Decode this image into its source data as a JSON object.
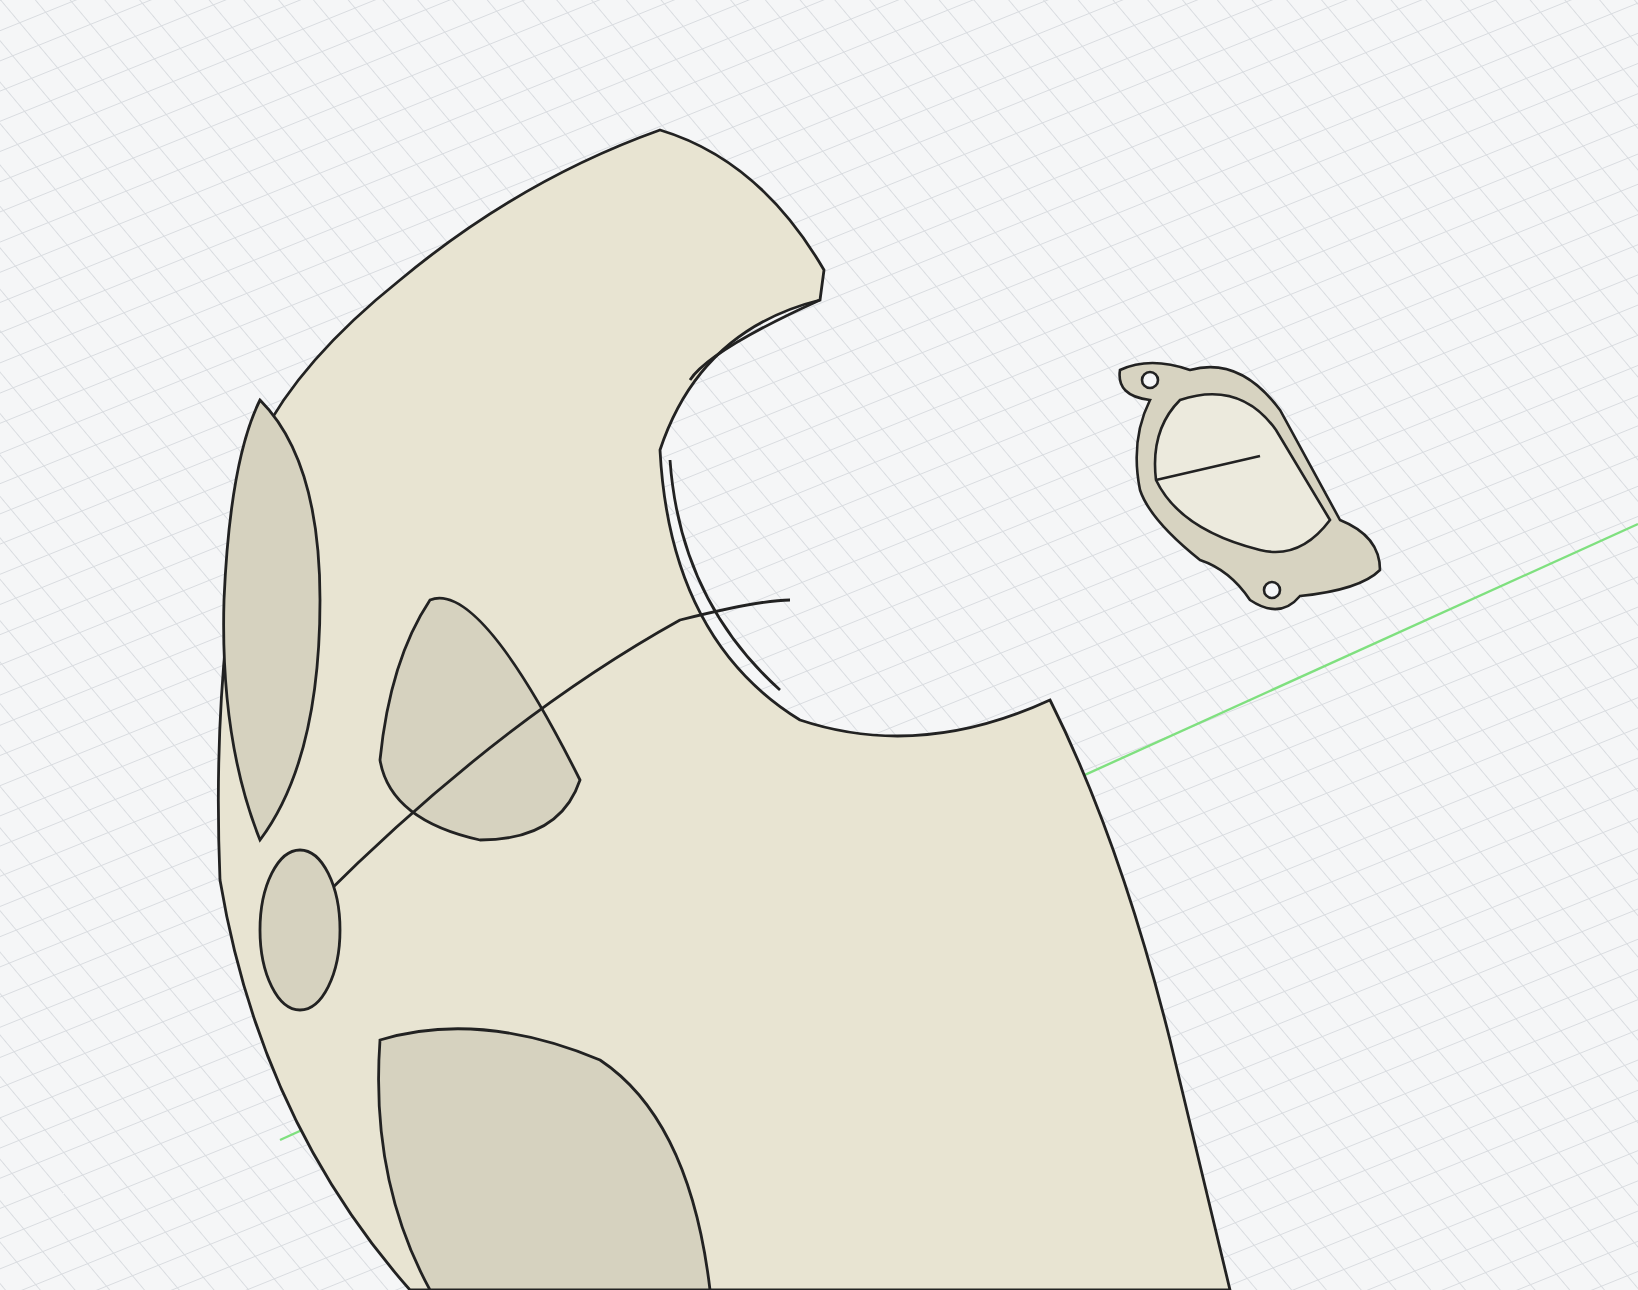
{
  "viewport": {
    "objects": [
      {
        "kind": "shell"
      },
      {
        "kind": "bracket"
      }
    ]
  }
}
